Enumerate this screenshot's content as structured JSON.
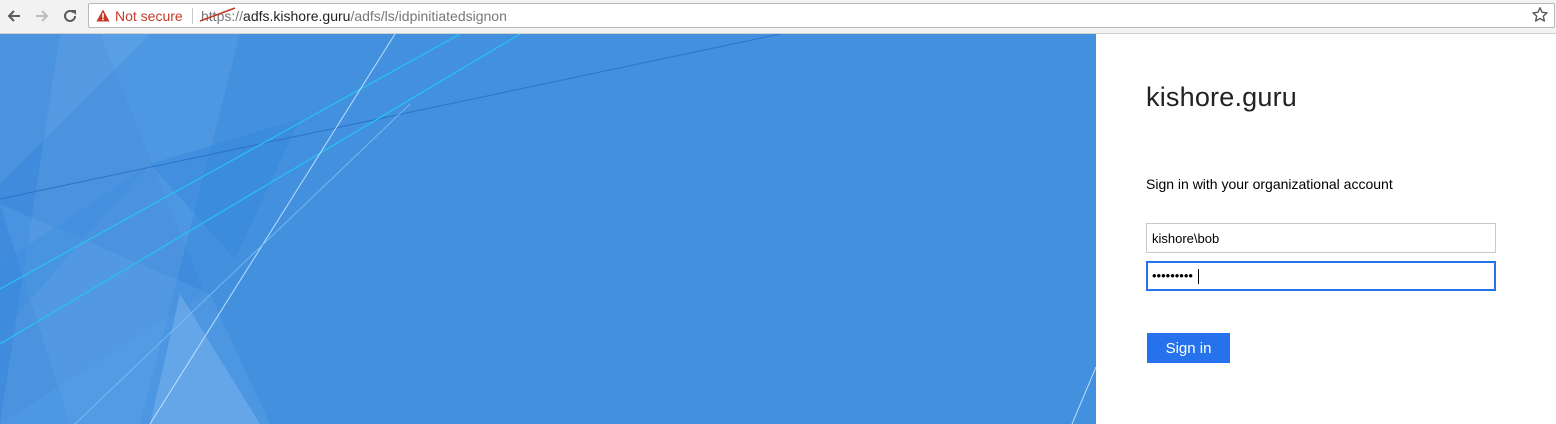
{
  "browser": {
    "security_label": "Not secure",
    "url_scheme": "https",
    "url_scheme_sep": "://",
    "url_host": "adfs.kishore.guru",
    "url_path": "/adfs/ls/idpinitiatedsignon"
  },
  "login": {
    "org_name": "kishore.guru",
    "intro": "Sign in with your organizational account",
    "username_value": "kishore\\bob",
    "password_masked": "•••••••••",
    "signin_label": "Sign in"
  },
  "colors": {
    "hero_bg": "#4390df",
    "accent": "#2672ec",
    "warning": "#c53929"
  }
}
